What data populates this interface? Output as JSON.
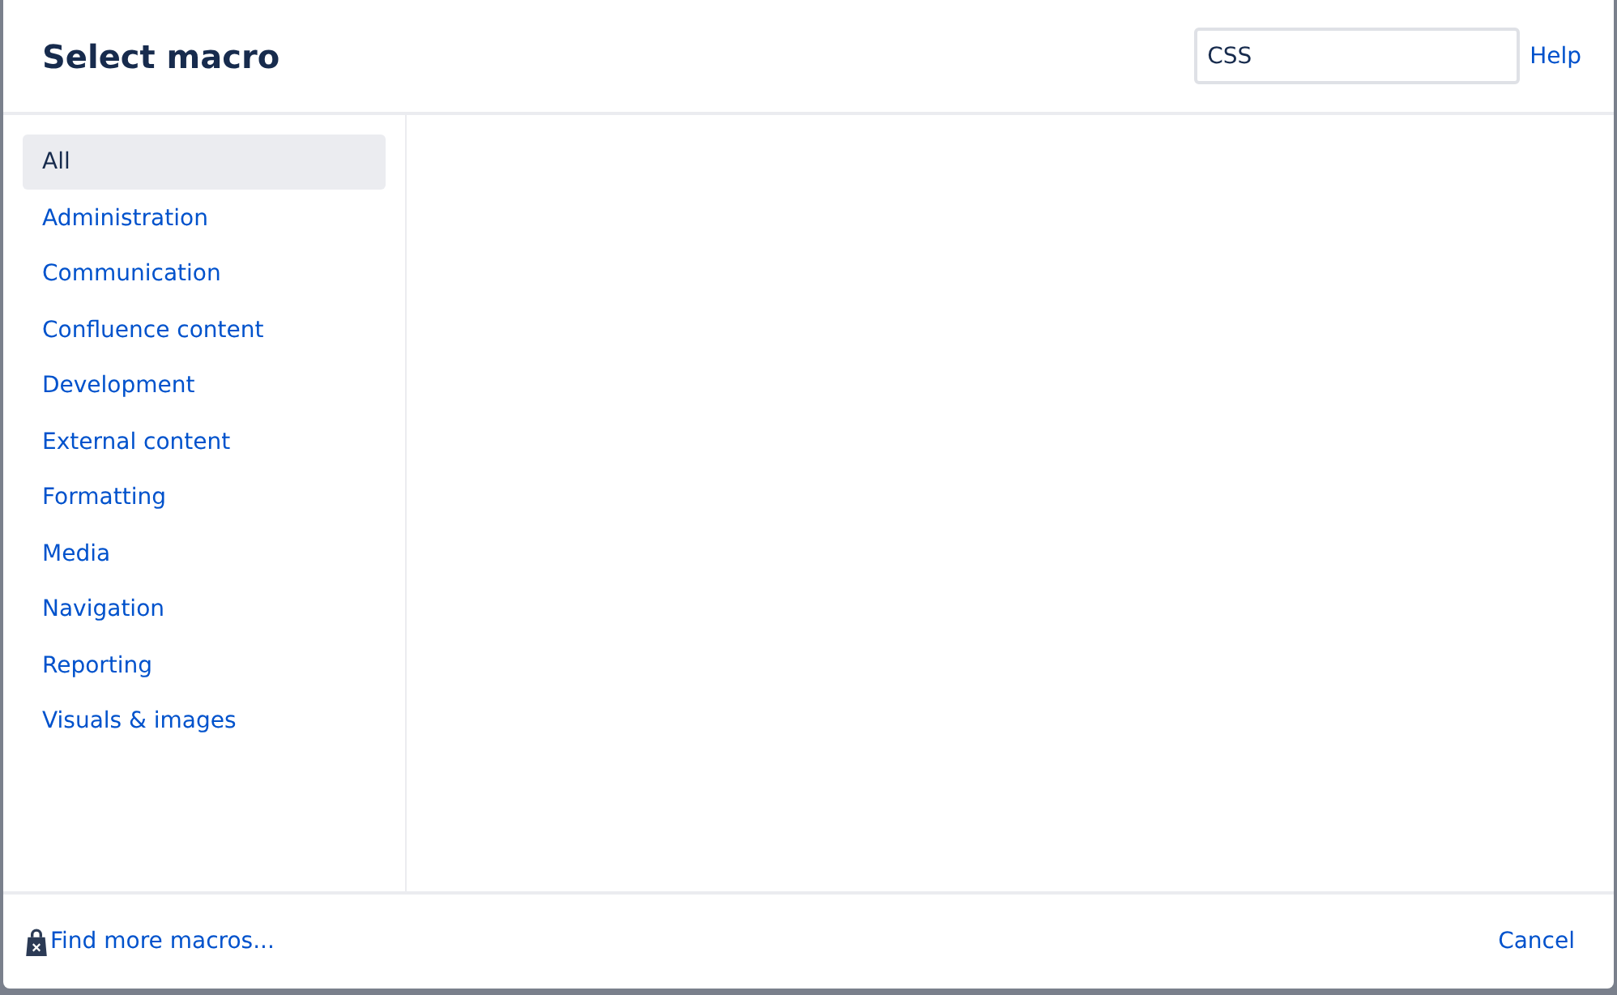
{
  "dialog": {
    "title": "Select macro",
    "search": {
      "value": "CSS"
    },
    "help_link": "Help"
  },
  "categories": [
    {
      "label": "All",
      "selected": true
    },
    {
      "label": "Administration",
      "selected": false
    },
    {
      "label": "Communication",
      "selected": false
    },
    {
      "label": "Confluence content",
      "selected": false
    },
    {
      "label": "Development",
      "selected": false
    },
    {
      "label": "External content",
      "selected": false
    },
    {
      "label": "Formatting",
      "selected": false
    },
    {
      "label": "Media",
      "selected": false
    },
    {
      "label": "Navigation",
      "selected": false
    },
    {
      "label": "Reporting",
      "selected": false
    },
    {
      "label": "Visuals & images",
      "selected": false
    }
  ],
  "footer": {
    "find_more_link": "Find more macros...",
    "cancel_button": "Cancel"
  }
}
